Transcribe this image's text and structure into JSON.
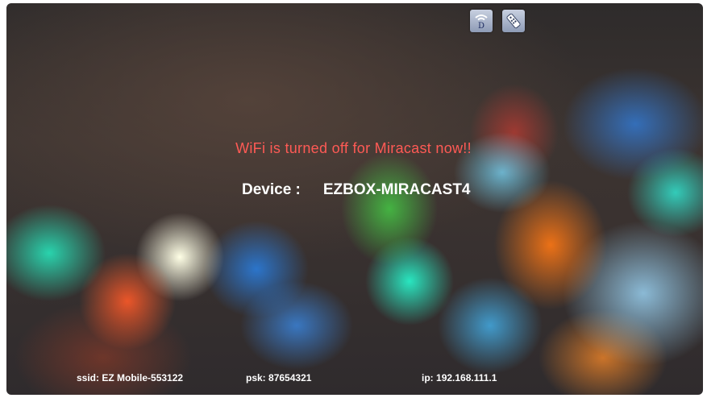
{
  "header": {
    "icons": [
      "wifi-d-icon",
      "remote-icon"
    ],
    "wifi_badge_letter": "D"
  },
  "main": {
    "status_message": "WiFi is turned off for Miracast now!!",
    "device_label": "Device :",
    "device_name": "EZBOX-MIRACAST4"
  },
  "footer": {
    "ssid_label": "ssid:",
    "ssid_value": "EZ Mobile-553122",
    "psk_label": "psk:",
    "psk_value": "87654321",
    "ip_label": "ip:",
    "ip_value": "192.168.111.1"
  },
  "colors": {
    "status_text": "#ff5a55",
    "info_text": "#ffffff"
  }
}
